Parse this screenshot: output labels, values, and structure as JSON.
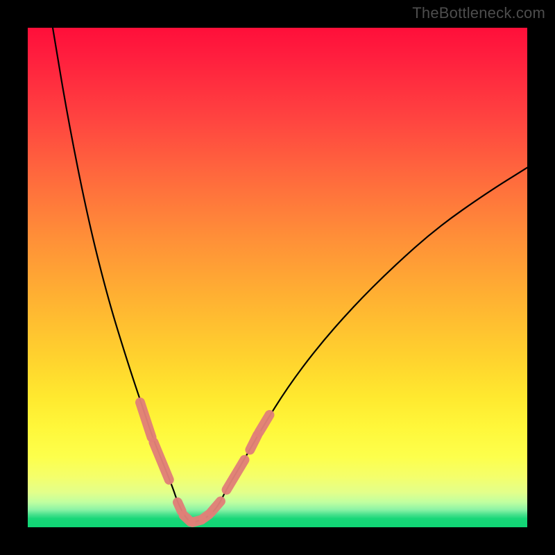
{
  "watermark": "TheBottleneck.com",
  "colors": {
    "frame": "#000000",
    "curve": "#000000",
    "marker": "#e18078",
    "gradient_top": "#ff0f3a",
    "gradient_mid": "#ffe92f",
    "gradient_bottom": "#10d675"
  },
  "chart_data": {
    "type": "line",
    "title": "",
    "xlabel": "",
    "ylabel": "",
    "xlim": [
      0,
      100
    ],
    "ylim": [
      0,
      100
    ],
    "grid": false,
    "series": [
      {
        "name": "bottleneck-curve",
        "x": [
          5,
          8,
          12,
          16,
          20,
          23,
          25,
          27,
          29,
          30,
          31,
          32,
          33,
          34,
          36,
          38,
          40,
          43,
          47,
          52,
          58,
          65,
          73,
          82,
          92,
          100
        ],
        "y": [
          100,
          82,
          62,
          46,
          33,
          24,
          18,
          13,
          8,
          5,
          3,
          1.5,
          1,
          1.2,
          2,
          4,
          8,
          13,
          20,
          28,
          36,
          44,
          52,
          60,
          67,
          72
        ]
      }
    ],
    "markers": {
      "name": "highlighted-segments",
      "segments": [
        {
          "x0": 22.5,
          "y0": 25.0,
          "x1": 24.8,
          "y1": 18.0
        },
        {
          "x0": 25.2,
          "y0": 17.0,
          "x1": 28.3,
          "y1": 9.5
        },
        {
          "x0": 30.0,
          "y0": 5.0,
          "x1": 30.8,
          "y1": 3.2
        },
        {
          "x0": 31.2,
          "y0": 2.4,
          "x1": 32.6,
          "y1": 1.1
        },
        {
          "x0": 33.0,
          "y0": 1.0,
          "x1": 34.8,
          "y1": 1.5
        },
        {
          "x0": 35.2,
          "y0": 1.8,
          "x1": 36.3,
          "y1": 2.6
        },
        {
          "x0": 36.7,
          "y0": 3.0,
          "x1": 38.6,
          "y1": 5.2
        },
        {
          "x0": 39.8,
          "y0": 7.5,
          "x1": 43.4,
          "y1": 13.5
        },
        {
          "x0": 44.5,
          "y0": 15.5,
          "x1": 46.0,
          "y1": 18.5
        },
        {
          "x0": 46.3,
          "y0": 19.0,
          "x1": 48.4,
          "y1": 22.5
        }
      ]
    }
  }
}
